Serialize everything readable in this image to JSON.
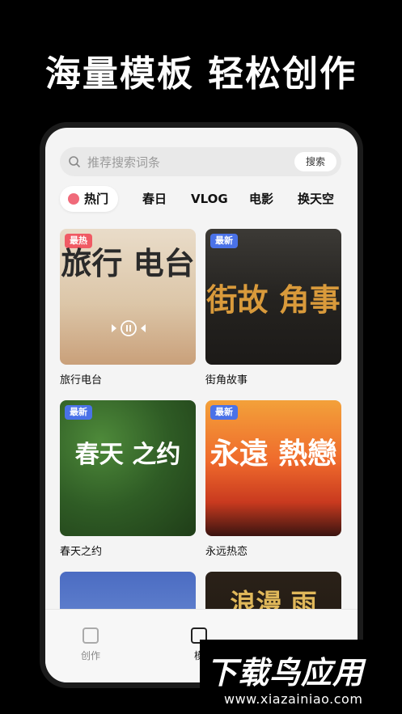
{
  "headline": "海量模板 轻松创作",
  "search": {
    "placeholder": "推荐搜索词条",
    "button": "搜索"
  },
  "categories": [
    {
      "label": "热门",
      "active": true
    },
    {
      "label": "春日"
    },
    {
      "label": "VLOG"
    },
    {
      "label": "电影"
    },
    {
      "label": "换天空"
    }
  ],
  "cards": [
    {
      "title": "旅行电台",
      "badge": "最热",
      "badge_type": "hot",
      "overlay": "旅行 电台"
    },
    {
      "title": "街角故事",
      "badge": "最新",
      "badge_type": "new",
      "overlay": "街故 角事"
    },
    {
      "title": "春天之约",
      "badge": "最新",
      "badge_type": "new",
      "overlay": "春天 之约"
    },
    {
      "title": "永远热恋",
      "badge": "最新",
      "badge_type": "new",
      "overlay": "永遠 熱戀"
    },
    {
      "title": "",
      "overlay": ""
    },
    {
      "title": "",
      "overlay": "浪漫 雨"
    }
  ],
  "tabbar": {
    "create": "创作",
    "template": "模"
  },
  "watermark": {
    "brand": "下载鸟应用",
    "url": "www.xiazainiao.com"
  },
  "colors": {
    "hot_badge": "#f05a64",
    "new_badge": "#4a72e8",
    "brand_green": "#42c94a"
  }
}
